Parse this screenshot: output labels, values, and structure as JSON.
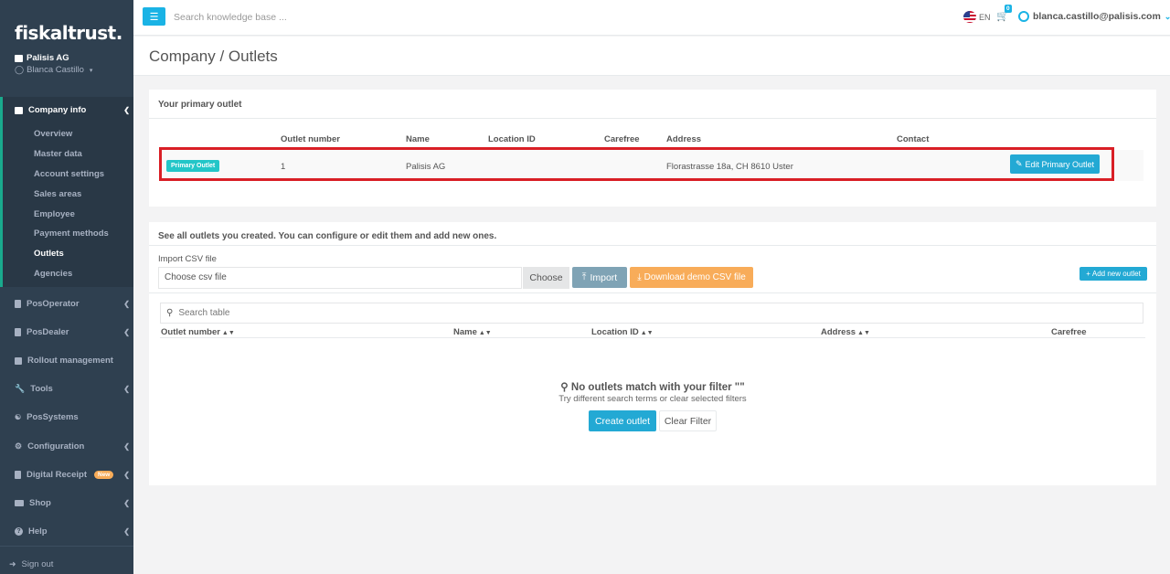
{
  "brand": {
    "logo": "fiskaltrust."
  },
  "account_header": {
    "company": "Palisis AG",
    "user": "Blanca Castillo"
  },
  "sidebar": {
    "sections": [
      {
        "label": "Company info",
        "icon": "briefcase-icon"
      },
      {
        "label": "PosOperator",
        "icon": "building-icon"
      },
      {
        "label": "PosDealer",
        "icon": "building-icon"
      },
      {
        "label": "Rollout management",
        "icon": "plus-square-icon"
      },
      {
        "label": "Tools",
        "icon": "wrench-icon"
      },
      {
        "label": "PosSystems",
        "icon": "sitemap-icon"
      },
      {
        "label": "Configuration",
        "icon": "cogs-icon"
      },
      {
        "label": "Digital Receipt",
        "icon": "file-icon",
        "badge": "New"
      },
      {
        "label": "Shop",
        "icon": "credit-card-icon"
      },
      {
        "label": "Help",
        "icon": "question-icon"
      }
    ],
    "company_items": [
      "Overview",
      "Master data",
      "Account settings",
      "Sales areas",
      "Employee",
      "Payment methods",
      "Outlets",
      "Agencies"
    ],
    "sign_out": "Sign out"
  },
  "topbar": {
    "search_placeholder": "Search knowledge base ...",
    "language": "EN",
    "cart_count": "0",
    "account_email": "blanca.castillo@palisis.com"
  },
  "page": {
    "title": "Company / Outlets"
  },
  "primary_outlet": {
    "heading": "Your primary outlet",
    "columns": [
      "Outlet number",
      "Name",
      "Location ID",
      "Carefree",
      "Address",
      "Contact"
    ],
    "badge": "Primary Outlet",
    "row": {
      "outlet_number": "1",
      "name": "Palisis AG",
      "location_id": "",
      "carefree": "",
      "address": "Florastrasse 18a, CH 8610 Uster",
      "contact": ""
    },
    "edit_button": "Edit Primary Outlet"
  },
  "outlets": {
    "intro": "See all outlets you created. You can configure or edit them and add new ones.",
    "import_label": "Import CSV file",
    "file_placeholder": "Choose csv file",
    "choose_button": "Choose",
    "import_button": "Import",
    "demo_button": "Download demo CSV file",
    "add_button": "Add new outlet",
    "search_placeholder": "Search table",
    "columns": [
      "Outlet number",
      "Name",
      "Location ID",
      "Address",
      "Carefree"
    ],
    "empty_title": "No outlets match with your filter \"\"",
    "empty_subtitle": "Try different search terms or clear selected filters",
    "create_button": "Create outlet",
    "clear_button": "Clear Filter"
  },
  "colors": {
    "sidebar": "#2f4050",
    "accent": "#23a9d4",
    "warning": "#f8ac59",
    "highlight": "#d91f26",
    "badge": "#23c6c8"
  }
}
